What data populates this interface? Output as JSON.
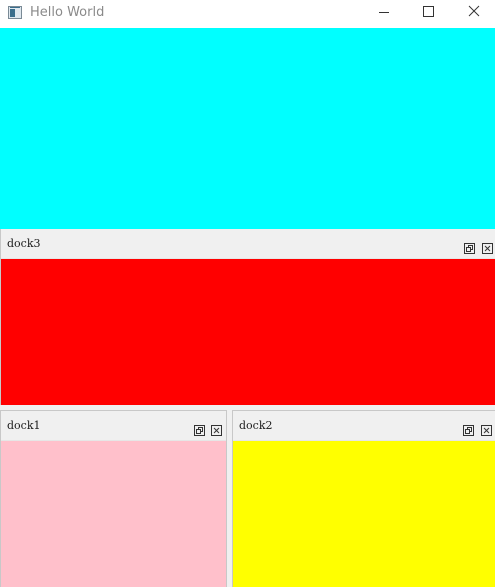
{
  "window": {
    "title": "Hello World",
    "icon": "app-window-icon",
    "controls": [
      "minimize-icon",
      "maximize-icon",
      "close-icon"
    ]
  },
  "central": {
    "color": "#00ffff"
  },
  "docks": [
    {
      "id": "dock3",
      "title": "dock3",
      "content_color": "#ff0000",
      "buttons": [
        "float-icon",
        "close-icon"
      ]
    },
    {
      "id": "dock1",
      "title": "dock1",
      "content_color": "#ffc0cb",
      "buttons": [
        "float-icon",
        "close-icon"
      ]
    },
    {
      "id": "dock2",
      "title": "dock2",
      "content_color": "#ffff00",
      "buttons": [
        "float-icon",
        "close-icon"
      ]
    }
  ]
}
